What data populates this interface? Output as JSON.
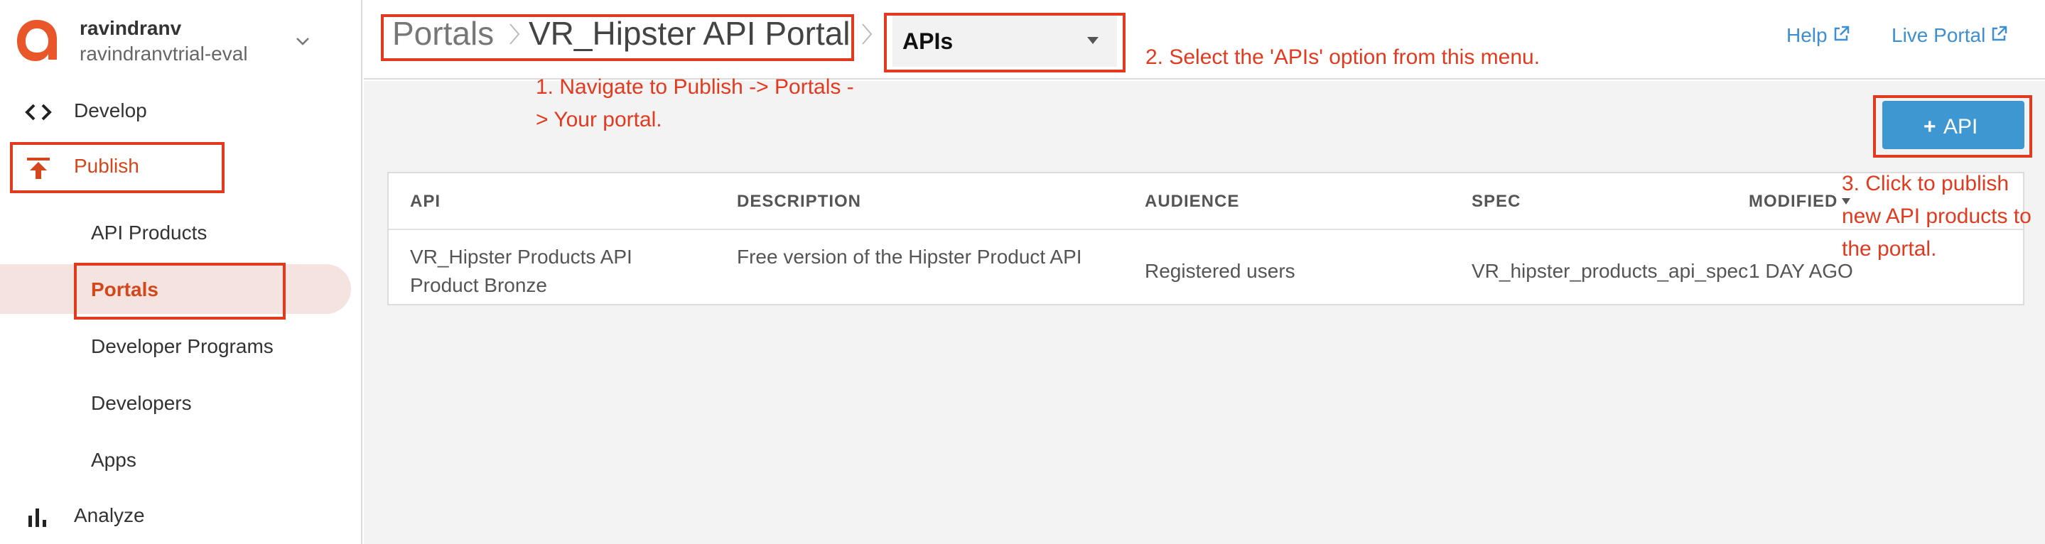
{
  "org": {
    "name": "ravindranv",
    "subname": "ravindranvtrial-eval"
  },
  "sidebar": {
    "develop": {
      "label": "Develop",
      "icon": "code-icon"
    },
    "publish": {
      "label": "Publish",
      "icon": "publish-icon"
    },
    "publish_items": [
      {
        "label": "API Products",
        "active": false
      },
      {
        "label": "Portals",
        "active": true
      },
      {
        "label": "Developer Programs",
        "active": false
      },
      {
        "label": "Developers",
        "active": false
      },
      {
        "label": "Apps",
        "active": false
      }
    ],
    "analyze": {
      "label": "Analyze",
      "icon": "bar-chart-icon"
    }
  },
  "header": {
    "breadcrumb": [
      "Portals",
      "VR_Hipster API Portal"
    ],
    "select": {
      "value": "APIs"
    },
    "links": {
      "help": "Help",
      "live_portal": "Live Portal"
    }
  },
  "main": {
    "add_button": {
      "icon": "+",
      "label": "API"
    },
    "table": {
      "columns": [
        "API",
        "DESCRIPTION",
        "AUDIENCE",
        "SPEC",
        "MODIFIED"
      ],
      "sort_column": "MODIFIED",
      "rows": [
        {
          "api": "VR_Hipster Products API Product Bronze",
          "description": "Free version of the Hipster Product API",
          "audience": "Registered users",
          "spec": "VR_hipster_products_api_spec",
          "modified": "1 DAY AGO"
        }
      ]
    }
  },
  "annotations": {
    "step1": "1. Navigate to Publish -> Portals -> Your portal.",
    "step2": "2. Select the 'APIs' option from this menu.",
    "step3": "3. Click to publish new API products to the portal."
  },
  "colors": {
    "brand": "#d4461c",
    "link": "#3d8fd0",
    "button": "#3e97d1",
    "annotation": "#e23a1f",
    "active_bg": "#f4e3de"
  }
}
